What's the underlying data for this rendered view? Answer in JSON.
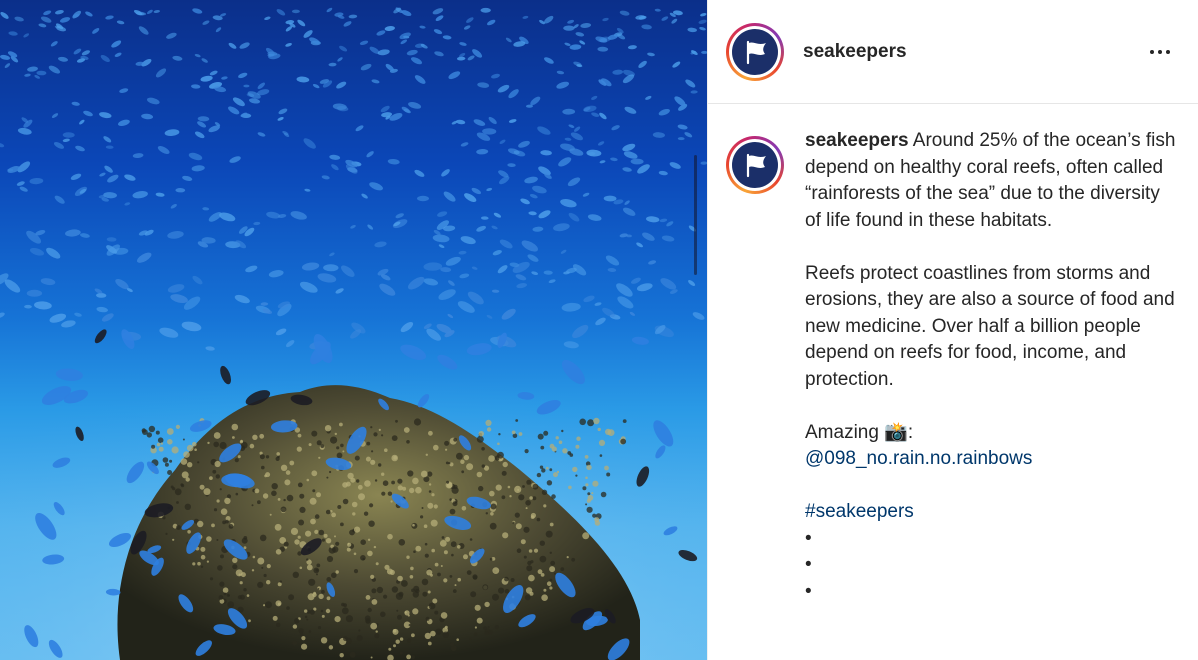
{
  "post": {
    "username": "seakeepers",
    "more_icon": "more-horizontal-icon",
    "avatar_icon": "flag-logo-icon"
  },
  "caption": {
    "username": "seakeepers",
    "paragraph1": "Around 25% of the ocean’s fish depend on healthy coral reefs, often called “rainforests of the sea” due to the diversity of life found in these habitats.",
    "paragraph2": "Reefs protect coastlines from storms and erosions, they are also a source of food and new medicine. Over half a billion people depend on reefs for food, income, and protection.",
    "credit_label": "Amazing 📸:",
    "credit_mention": "@098_no.rain.no.rainbows",
    "hashtag": "#seakeepers",
    "bullets": [
      "•",
      "•",
      "•"
    ]
  },
  "colors": {
    "link": "#00376b",
    "avatar_bg": "#1b2f69",
    "ocean_deep": "#0b2f8a",
    "ocean_light": "#6cc2f3"
  }
}
